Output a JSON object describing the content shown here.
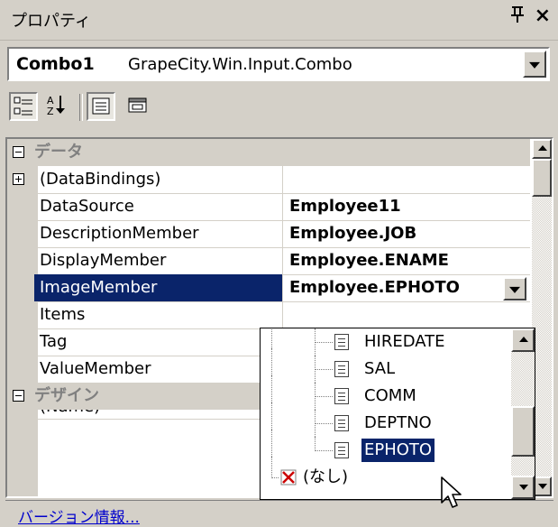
{
  "window": {
    "title": "プロパティ",
    "pin_glyph": "ᵠ",
    "close_glyph": "×"
  },
  "object_selector": {
    "name": "Combo1",
    "type": "GrapeCity.Win.Input.Combo"
  },
  "toolbar": {
    "buttons": [
      "categorized-view",
      "alphabetical-view",
      "properties-view",
      "property-pages"
    ]
  },
  "grid": {
    "rows": [
      {
        "kind": "category",
        "label": "データ",
        "expander": "minus"
      },
      {
        "kind": "property",
        "label": "(DataBindings)",
        "value": "",
        "expander": "plus"
      },
      {
        "kind": "property",
        "label": "DataSource",
        "value": "Employee11"
      },
      {
        "kind": "property",
        "label": "DescriptionMember",
        "value": "Employee.JOB"
      },
      {
        "kind": "property",
        "label": "DisplayMember",
        "value": "Employee.ENAME"
      },
      {
        "kind": "property",
        "label": "ImageMember",
        "value": "Employee.EPHOTO",
        "selected": true
      },
      {
        "kind": "property",
        "label": "Items",
        "value": ""
      },
      {
        "kind": "property",
        "label": "Tag",
        "value": ""
      },
      {
        "kind": "property",
        "label": "ValueMember",
        "value": ""
      },
      {
        "kind": "category",
        "label": "デザイン",
        "expander": "minus"
      },
      {
        "kind": "property",
        "label": "(Name)",
        "value": ""
      }
    ]
  },
  "dropdown": {
    "items": [
      {
        "label": "HIREDATE"
      },
      {
        "label": "SAL"
      },
      {
        "label": "COMM"
      },
      {
        "label": "DEPTNO"
      },
      {
        "label": "EPHOTO",
        "selected": true
      },
      {
        "label": "(なし)",
        "none": true
      }
    ]
  },
  "footer": {
    "version_link": "バージョン情報..."
  },
  "colors": {
    "selection": "#0a246a",
    "face": "#d4d0c8",
    "link": "#0000cc"
  }
}
